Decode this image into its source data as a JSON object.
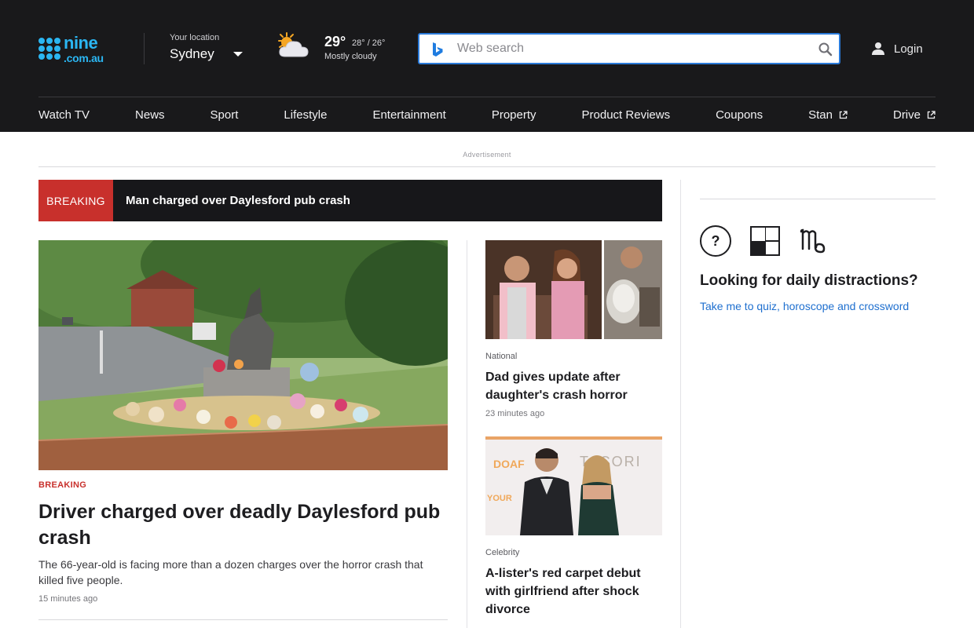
{
  "header": {
    "logo": {
      "line1": "nine",
      "line2": ".com.au"
    },
    "location": {
      "label": "Your location",
      "city": "Sydney"
    },
    "weather": {
      "temp": "29°",
      "range": "28° / 26°",
      "condition": "Mostly cloudy",
      "icon": "partly-cloudy-icon"
    },
    "search": {
      "placeholder": "Web search",
      "value": ""
    },
    "login_label": "Login"
  },
  "nav": [
    {
      "label": "Watch TV",
      "external": false
    },
    {
      "label": "News",
      "external": false
    },
    {
      "label": "Sport",
      "external": false
    },
    {
      "label": "Lifestyle",
      "external": false
    },
    {
      "label": "Entertainment",
      "external": false
    },
    {
      "label": "Property",
      "external": false
    },
    {
      "label": "Product Reviews",
      "external": false
    },
    {
      "label": "Coupons",
      "external": false
    },
    {
      "label": "Stan",
      "external": true
    },
    {
      "label": "Drive",
      "external": true
    }
  ],
  "ad_label": "Advertisement",
  "breaking": {
    "tag": "BREAKING",
    "text": "Man charged over Daylesford pub crash"
  },
  "hero": {
    "tag": "BREAKING",
    "title": "Driver charged over deadly Daylesford pub crash",
    "desc": "The 66-year-old is facing more than a dozen charges over the horror crash that killed five people.",
    "time": "15 minutes ago"
  },
  "cards": [
    {
      "category": "National",
      "title": "Dad gives update after daughter's crash horror",
      "time": "23 minutes ago"
    },
    {
      "category": "Celebrity",
      "title": "A-lister's red carpet debut with girlfriend after shock divorce",
      "time": ""
    }
  ],
  "sidebar": {
    "icons": [
      "quiz-icon",
      "crossword-icon",
      "horoscope-icon"
    ],
    "quiz_glyph": "?",
    "title": "Looking for daily distractions?",
    "link": "Take me to quiz, horoscope and crossword"
  },
  "colors": {
    "header_bg": "#19191b",
    "brand": "#2bb6f2",
    "breaking_red": "#c8302c",
    "link_blue": "#1e6fcf",
    "search_border": "#2a7ad9"
  }
}
